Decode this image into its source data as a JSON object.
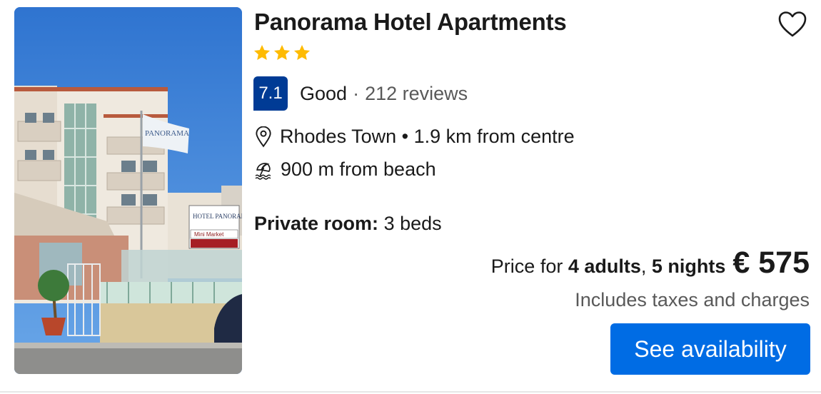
{
  "hotel": {
    "name": "Panorama Hotel Apartments",
    "star_count": 3,
    "photo_sign_text": "PANORAMA",
    "photo_building_sign": "HOTEL PANORAMA",
    "photo_shop_sign": "Mini Market"
  },
  "rating": {
    "score": "7.1",
    "word": "Good",
    "separator": "·",
    "reviews": "212 reviews"
  },
  "location": {
    "text": "Rhodes Town • 1.9 km from centre",
    "icon": "map-pin-icon"
  },
  "beach": {
    "text": "900 m from beach",
    "icon": "beach-umbrella-icon"
  },
  "room": {
    "label": "Private room:",
    "beds": " 3 beds"
  },
  "pricing": {
    "prefix": "Price for ",
    "adults": "4 adults",
    "comma": ", ",
    "nights": "5 nights",
    "price": "€ 575",
    "taxes": "Includes taxes and charges"
  },
  "actions": {
    "see_availability": "See availability",
    "favorite_icon": "heart-icon"
  },
  "colors": {
    "score_bg": "#003b95",
    "cta_bg": "#006ce4",
    "star": "#febb02",
    "muted_text": "#595959"
  }
}
